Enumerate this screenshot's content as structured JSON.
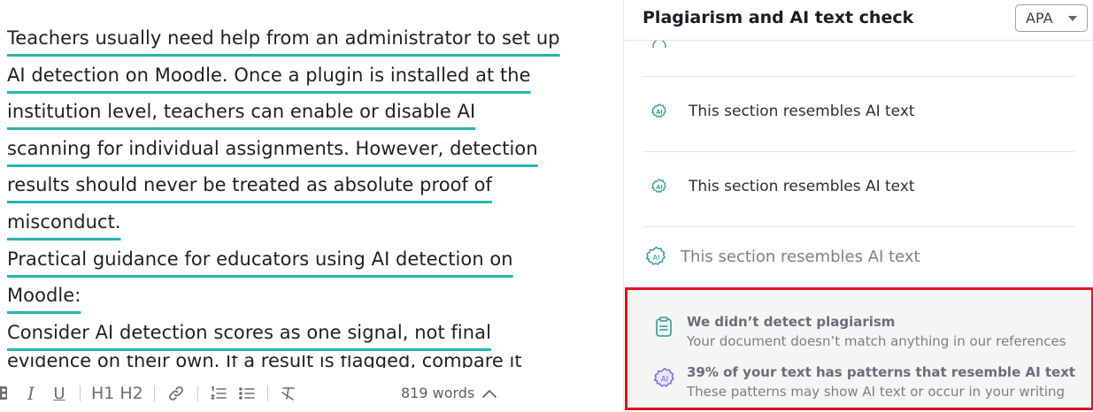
{
  "editor": {
    "paragraphs": [
      "Teachers usually need help from an administrator to set up AI detection on Moodle. Once a plugin is installed at the institution level, teachers can enable or disable AI scanning for individual assignments. However, detection results should never be treated as absolute proof of misconduct.",
      "Practical guidance for educators using AI detection on Moodle:",
      "Consider AI detection scores as one signal, not final"
    ],
    "lines": [
      "Teachers usually need help from an administrator to set up",
      "AI detection on Moodle. Once a plugin is installed at the",
      "institution level, teachers can enable or disable AI",
      "scanning for individual assignments. However, detection",
      "results should never be treated as absolute proof of",
      "misconduct.",
      "Practical guidance for educators using AI detection on",
      "Moodle:",
      "Consider AI detection scores as one signal, not final"
    ],
    "partial_line": "evidence on their own. If a result is flagged, compare it",
    "word_count": "819 words",
    "toolbar": {
      "bold": "B",
      "italic": "I",
      "underline": "U",
      "h1": "H1",
      "h2": "H2"
    },
    "underline_color": "#26b5b2"
  },
  "panel": {
    "title": "Plagiarism and AI text check",
    "citation_style": "APA",
    "items": [
      {
        "label": "This section resembles AI text",
        "icon": "ai-badge-icon"
      },
      {
        "label": "This section resembles AI text",
        "icon": "ai-badge-icon"
      },
      {
        "label": "This section resembles AI text",
        "icon": "ai-badge-icon"
      }
    ],
    "summary": {
      "plagiarism_title": "We didn’t detect plagiarism",
      "plagiarism_desc": "Your document doesn’t match anything in our references",
      "ai_title": "39% of your text has patterns that resemble AI text",
      "ai_desc": "These patterns may show AI text or occur in your writing",
      "ai_percent": 39,
      "highlight_color": "#e0141b"
    }
  }
}
